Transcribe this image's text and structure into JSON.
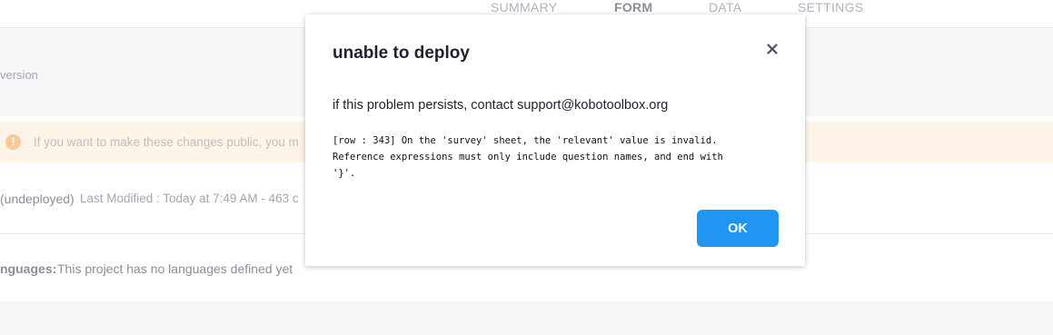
{
  "nav": {
    "tabs": [
      {
        "label": "SUMMARY"
      },
      {
        "label": "FORM"
      },
      {
        "label": "DATA"
      },
      {
        "label": "SETTINGS"
      }
    ]
  },
  "version": {
    "text": "version"
  },
  "warning": {
    "text": "If you want to make these changes public, you m",
    "icon": "!"
  },
  "deploy": {
    "status": "(undeployed)",
    "modified": "Last Modified : Today at 7:49 AM - 463 c"
  },
  "languages": {
    "label": "nguages:",
    "value": "This project has no languages defined yet"
  },
  "modal": {
    "title": "unable to deploy",
    "close_icon": "close-icon",
    "message": "if this problem persists, contact support@kobotoolbox.org",
    "error": "[row : 343] On the 'survey' sheet, the 'relevant' value is invalid.\nReference expressions must only include question names, and end with\n'}'.",
    "ok_label": "OK"
  },
  "colors": {
    "accent": "#2095f2",
    "warning_bg": "#fdf3e7",
    "warning_icon": "#f7c89a"
  }
}
